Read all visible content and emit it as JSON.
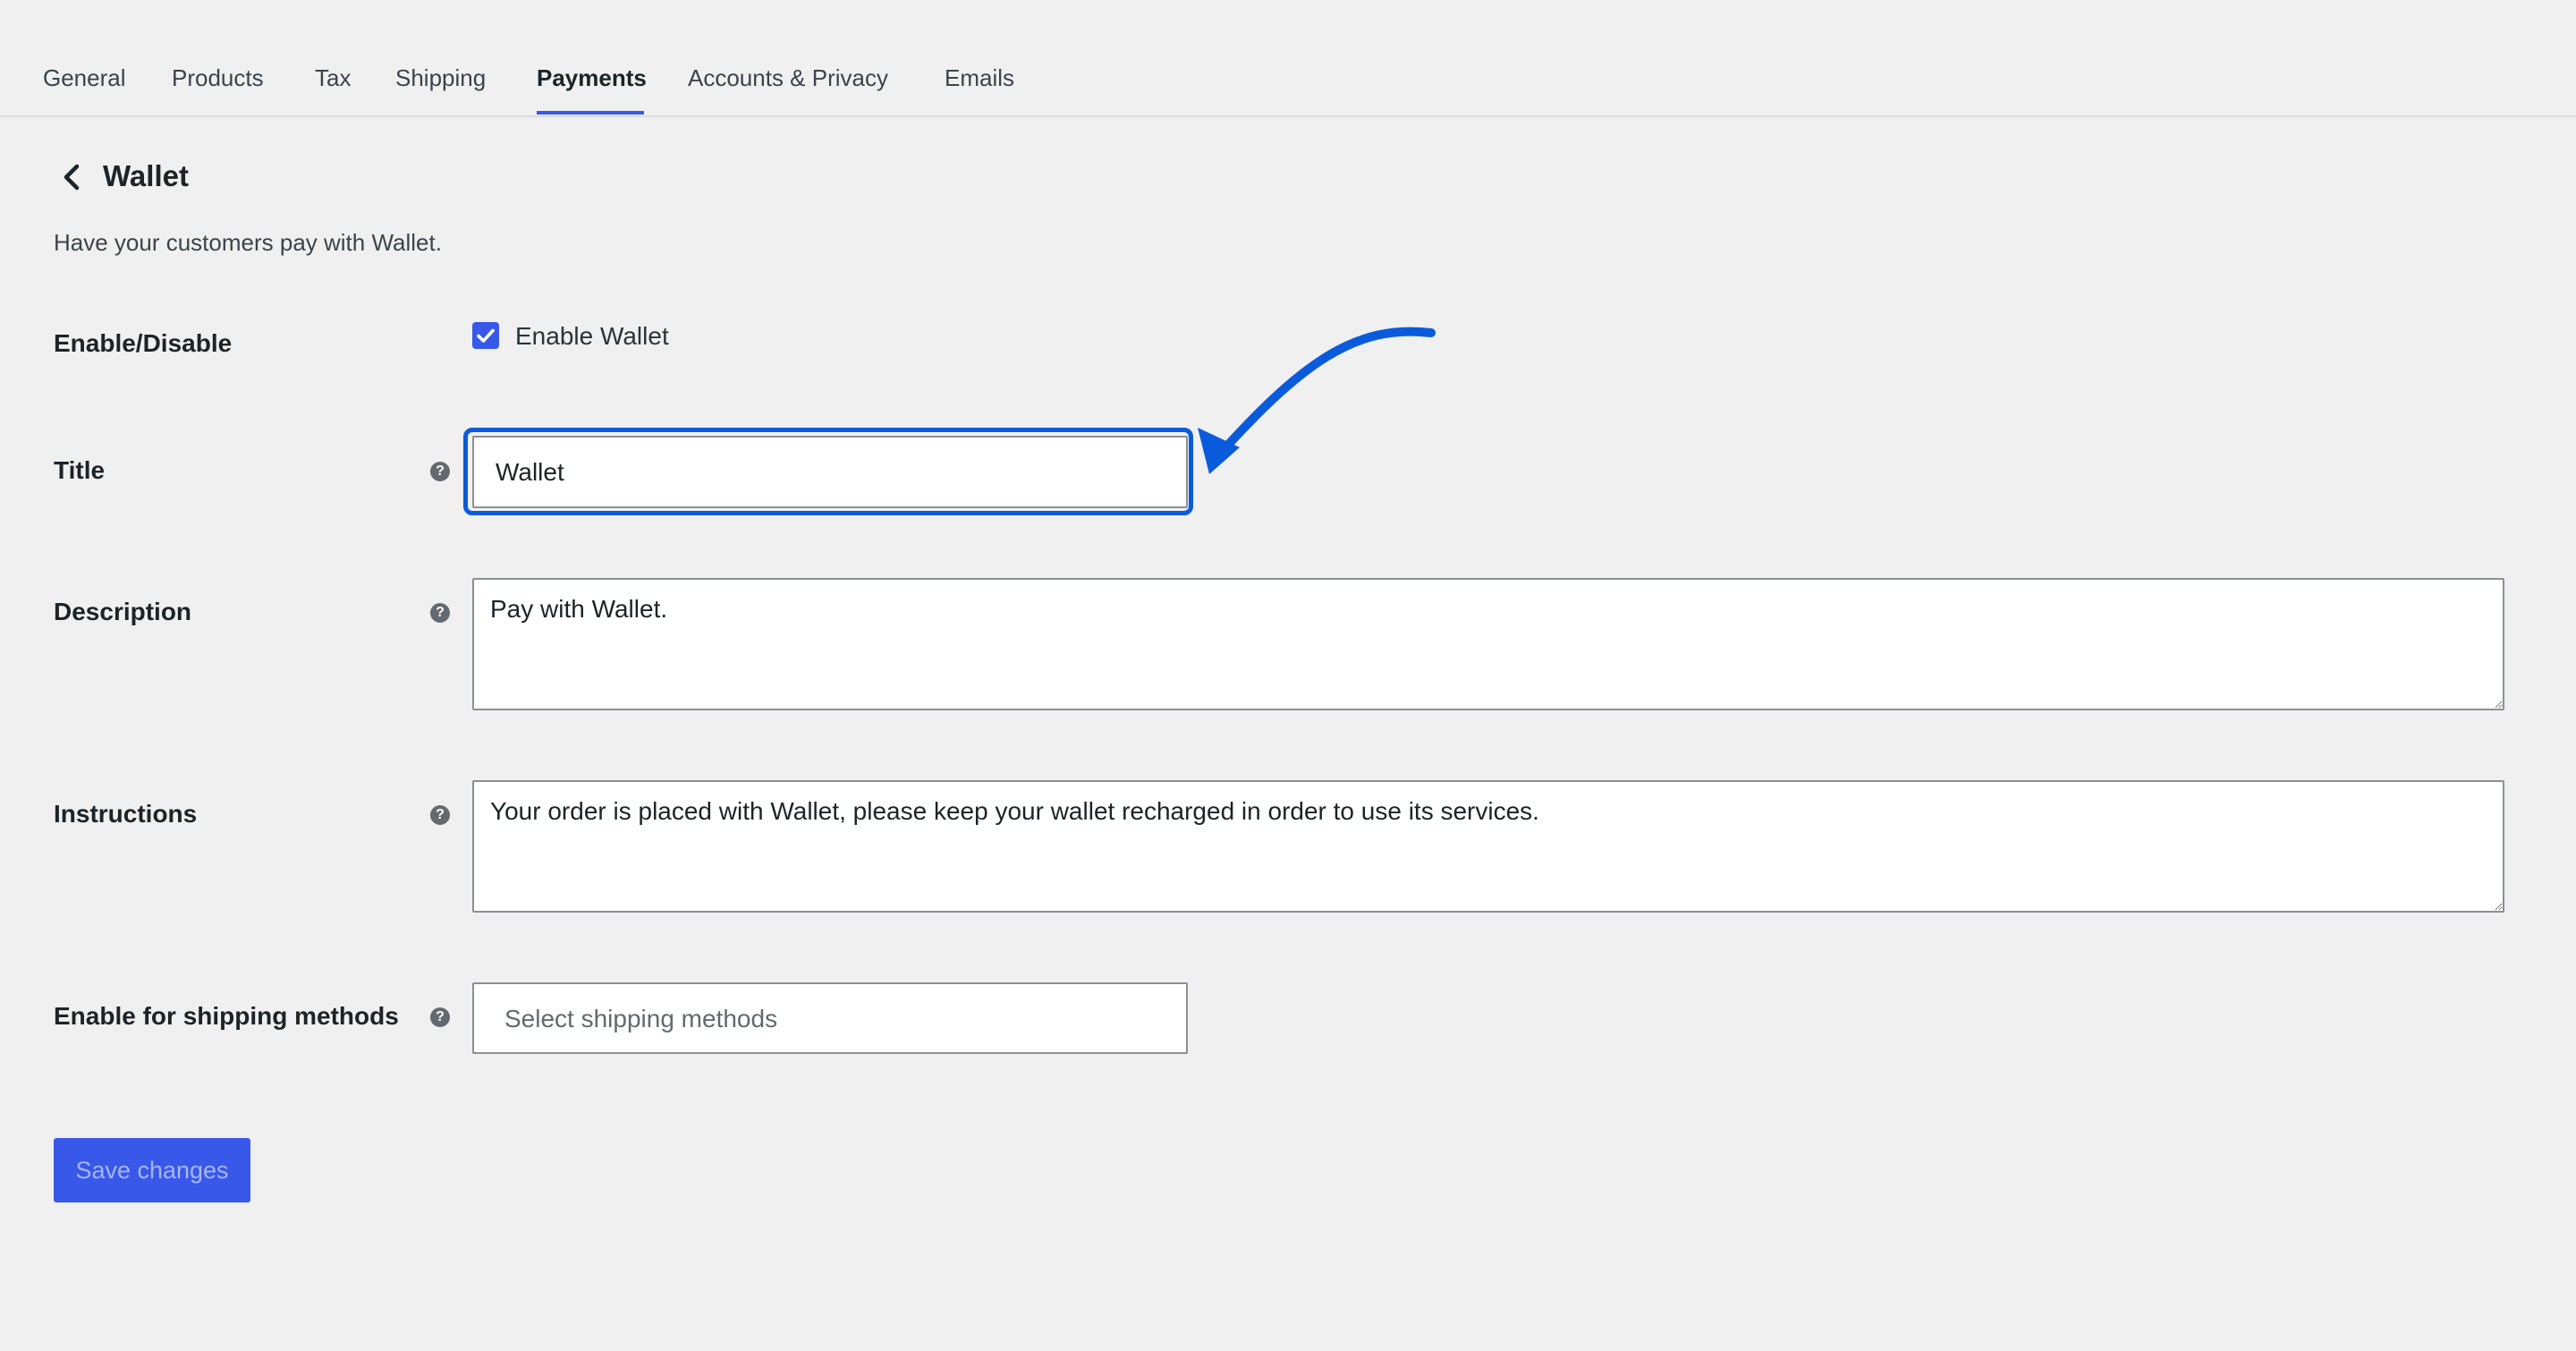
{
  "tabs": [
    {
      "label": "General"
    },
    {
      "label": "Products"
    },
    {
      "label": "Tax"
    },
    {
      "label": "Shipping"
    },
    {
      "label": "Payments",
      "active": true
    },
    {
      "label": "Accounts & Privacy"
    },
    {
      "label": "Emails"
    }
  ],
  "header": {
    "title": "Wallet",
    "description": "Have your customers pay with Wallet."
  },
  "form": {
    "enable": {
      "label": "Enable/Disable",
      "checkbox_label": "Enable Wallet",
      "checked": true
    },
    "title": {
      "label": "Title",
      "value": "Wallet"
    },
    "description": {
      "label": "Description",
      "value": "Pay with Wallet."
    },
    "instructions": {
      "label": "Instructions",
      "value": "Your order is placed with Wallet, please keep your wallet recharged in order to use its services."
    },
    "shipping": {
      "label": "Enable for shipping methods",
      "placeholder": "Select shipping methods"
    }
  },
  "save_label": "Save changes",
  "help_glyph": "?",
  "colors": {
    "accent": "#3858e9",
    "annotation": "#0a5bdc",
    "background": "#f0f0f1"
  },
  "icons": {
    "back": "chevron-left-icon",
    "help": "help-icon",
    "check": "checkmark-icon",
    "annotation": "curved-arrow-icon"
  }
}
